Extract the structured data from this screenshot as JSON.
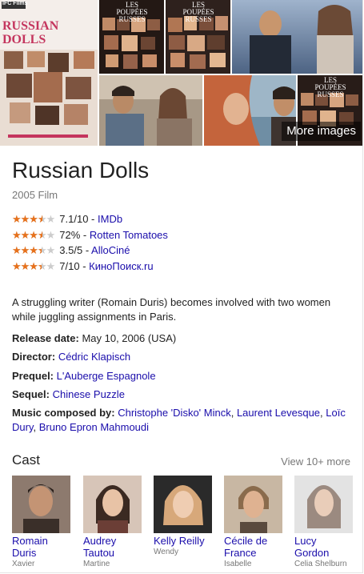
{
  "gallery": {
    "more_label": "More images",
    "images": [
      {
        "name": "poster-image",
        "c1": "#f3ece8",
        "c2": "#c4355e"
      },
      {
        "name": "poster-russes-image-1",
        "c1": "#2a1d1a",
        "c2": "#d89a6c"
      },
      {
        "name": "poster-russes-image-2",
        "c1": "#3b2a2a",
        "c2": "#b76a4a"
      },
      {
        "name": "couple-image",
        "c1": "#6b7d9c",
        "c2": "#a79073"
      },
      {
        "name": "man-portrait-image",
        "c1": "#b58a5f",
        "c2": "#6e4b35"
      },
      {
        "name": "couple-street-image",
        "c1": "#7b6d64",
        "c2": "#c7b39a"
      },
      {
        "name": "couple-river-image",
        "c1": "#8aa5b9",
        "c2": "#bc7a55"
      },
      {
        "name": "poster-russes-image-3",
        "c1": "#30241f",
        "c2": "#c57e5a"
      }
    ],
    "poster": {
      "studio": "IFC Films",
      "title": "RUSSIAN DOLLS"
    },
    "poster_russes": {
      "title": "LES POUPÉES RUSSES"
    }
  },
  "movie": {
    "title": "Russian Dolls",
    "subtitle": "2005 Film"
  },
  "ratings": [
    {
      "score": "7.1/10",
      "source": "IMDb",
      "fraction": 0.71
    },
    {
      "score": "72%",
      "source": "Rotten Tomatoes",
      "fraction": 0.72
    },
    {
      "score": "3.5/5",
      "source": "AlloCiné",
      "fraction": 0.7
    },
    {
      "score": "7/10",
      "source": "КиноПоиск.ru",
      "fraction": 0.7
    }
  ],
  "description": "A struggling writer (Romain Duris) becomes involved with two women while juggling assignments in Paris.",
  "facts": {
    "release": {
      "label": "Release date:",
      "value": "May 10, 2006 (USA)"
    },
    "director": {
      "label": "Director:",
      "value": "Cédric Klapisch"
    },
    "prequel": {
      "label": "Prequel:",
      "value": "L'Auberge Espagnole"
    },
    "sequel": {
      "label": "Sequel:",
      "value": "Chinese Puzzle"
    },
    "music": {
      "label": "Music composed by:",
      "values": [
        "Christophe 'Disko' Minck",
        "Laurent Levesque",
        "Loïc Dury",
        "Bruno Epron Mahmoudi"
      ],
      "separator": ", "
    }
  },
  "cast": {
    "heading": "Cast",
    "more": "View 10+ more",
    "members": [
      {
        "name": "Romain Duris",
        "role": "Xavier",
        "c1": "#8d7a6e",
        "c2": "#3a2f29"
      },
      {
        "name": "Audrey Tautou",
        "role": "Martine",
        "c1": "#d7c5b8",
        "c2": "#3b2a22"
      },
      {
        "name": "Kelly Reilly",
        "role": "Wendy",
        "c1": "#2a2a2a",
        "c2": "#d7a87a"
      },
      {
        "name": "Cécile de France",
        "role": "Isabelle",
        "c1": "#c8b7a3",
        "c2": "#8a6b4c"
      },
      {
        "name": "Lucy Gordon",
        "role": "Celia Shelburn",
        "c1": "#e3e3e3",
        "c2": "#9b8a80"
      }
    ]
  }
}
